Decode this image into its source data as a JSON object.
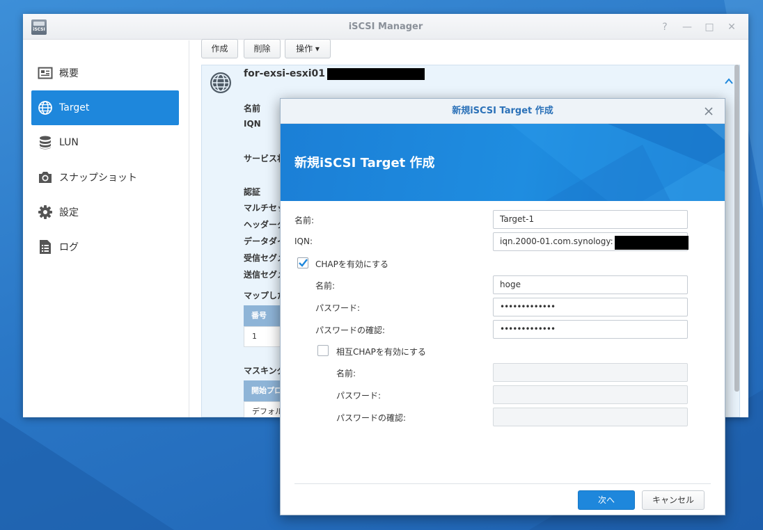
{
  "window": {
    "title": "iSCSI Manager",
    "app_icon_text": "iSCSI",
    "controls": {
      "help": "?",
      "minimize": "—",
      "maximize": "□",
      "close": "✕"
    }
  },
  "sidebar": {
    "items": [
      {
        "label": "概要",
        "icon": "overview-icon"
      },
      {
        "label": "Target",
        "icon": "globe-icon",
        "active": true
      },
      {
        "label": "LUN",
        "icon": "database-icon"
      },
      {
        "label": "スナップショット",
        "icon": "camera-icon"
      },
      {
        "label": "設定",
        "icon": "gear-icon"
      },
      {
        "label": "ログ",
        "icon": "log-icon"
      }
    ]
  },
  "toolbar": {
    "create": "作成",
    "delete": "削除",
    "operation": "操作 ▾"
  },
  "target": {
    "name": "for-exsi-esxi01",
    "labels": {
      "name": "名前",
      "iqn": "IQN",
      "service": "サービス状",
      "auth": "認証",
      "multi_session": "マルチセッ",
      "header_digest": "ヘッダーダ",
      "data_digest": "データダイ",
      "recv_segment": "受信セグメ",
      "send_segment": "送信セグメ",
      "mapped_lun": "マップした",
      "masking": "マスキング"
    },
    "lun_table": {
      "header": "番号",
      "row": "1"
    },
    "mask_table": {
      "header": "開始プロ",
      "row": "デフォル"
    }
  },
  "dialog": {
    "title": "新規iSCSI Target 作成",
    "banner_title": "新規iSCSI Target 作成",
    "fields": {
      "name_label": "名前:",
      "name_value": "Target-1",
      "iqn_label": "IQN:",
      "iqn_value": "iqn.2000-01.com.synology:",
      "chap_label": "CHAPを有効にする",
      "chap_name_label": "名前:",
      "chap_name_value": "hoge",
      "chap_password_label": "パスワード:",
      "chap_password_value": "•••••••••••••",
      "chap_confirm_label": "パスワードの確認:",
      "chap_confirm_value": "•••••••••••••",
      "mutual_chap_label": "相互CHAPを有効にする",
      "mutual_name_label": "名前:",
      "mutual_password_label": "パスワード:",
      "mutual_confirm_label": "パスワードの確認:"
    },
    "chap_enabled": true,
    "mutual_chap_enabled": false,
    "buttons": {
      "next": "次へ",
      "cancel": "キャンセル"
    }
  },
  "colors": {
    "accent": "#1e87dc",
    "desktop": "#2a77c6",
    "panel_bg": "#eaf4fc"
  }
}
